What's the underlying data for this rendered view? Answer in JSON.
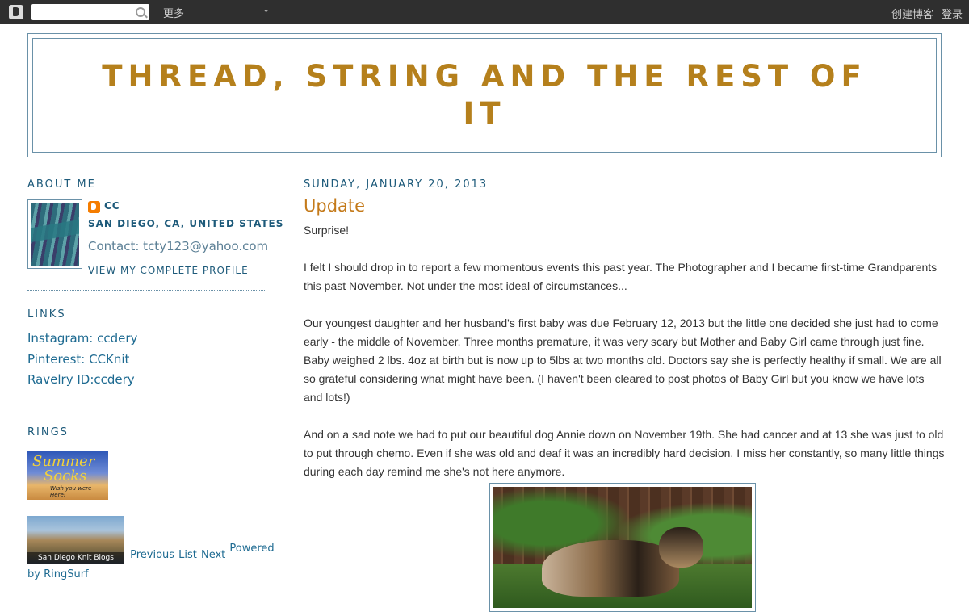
{
  "navbar": {
    "more_label": "更多",
    "create_blog_label": "创建博客",
    "login_label": "登录"
  },
  "header": {
    "title": "THREAD, STRING AND THE REST OF IT"
  },
  "sidebar": {
    "about_heading": "ABOUT ME",
    "profile": {
      "name": "CC",
      "location": "SAN DIEGO, CA, UNITED STATES",
      "contact": "Contact: tcty123@yahoo.com",
      "view_profile": "VIEW MY COMPLETE PROFILE"
    },
    "links_heading": "LINKS",
    "links": [
      "Instagram: ccdery",
      "Pinterest: CCKnit",
      "Ravelry ID:ccdery"
    ],
    "rings_heading": "RINGS",
    "ring1": {
      "line1": "Summer",
      "line2": "Socks",
      "line3": "Wish you were Here!"
    },
    "ring2": {
      "caption": "San Diego Knit Blogs"
    },
    "ring_prev": "Previous",
    "ring_list": "List",
    "ring_next": "Next",
    "ring_powered": "Powered",
    "ring_by": "by RingSurf"
  },
  "post": {
    "date": "SUNDAY, JANUARY 20, 2013",
    "title": "Update",
    "paragraphs": [
      "Surprise!",
      "I felt I should drop in to report a few momentous events this past year.  The Photographer and I became first-time Grandparents this past November.  Not under the most ideal of circumstances...",
      "Our youngest daughter and her husband's first baby was due February 12, 2013 but the little one decided she just had to come early - the middle of November.  Three months premature, it was very scary but Mother and Baby Girl came through just fine.  Baby weighed 2 lbs. 4oz at birth but is now up to 5lbs at two months old.  Doctors say she is perfectly healthy if small.  We are all so grateful considering what might have been. (I haven't been cleared to post photos of Baby Girl but you know we have lots and lots!)",
      "And on a sad note we had to put our beautiful dog Annie down on November 19th.  She had cancer and at 13 she was just to old to put through chemo.  Even if she was old and deaf it was an incredibly hard decision.  I miss her constantly, so many little things during each day remind me she's not here anymore."
    ]
  },
  "colors": {
    "title": "#b5801c",
    "heading": "#1d5a7a",
    "post_title": "#c47a1a",
    "border": "#6a91a8",
    "navbar": "#2f2f2f"
  }
}
